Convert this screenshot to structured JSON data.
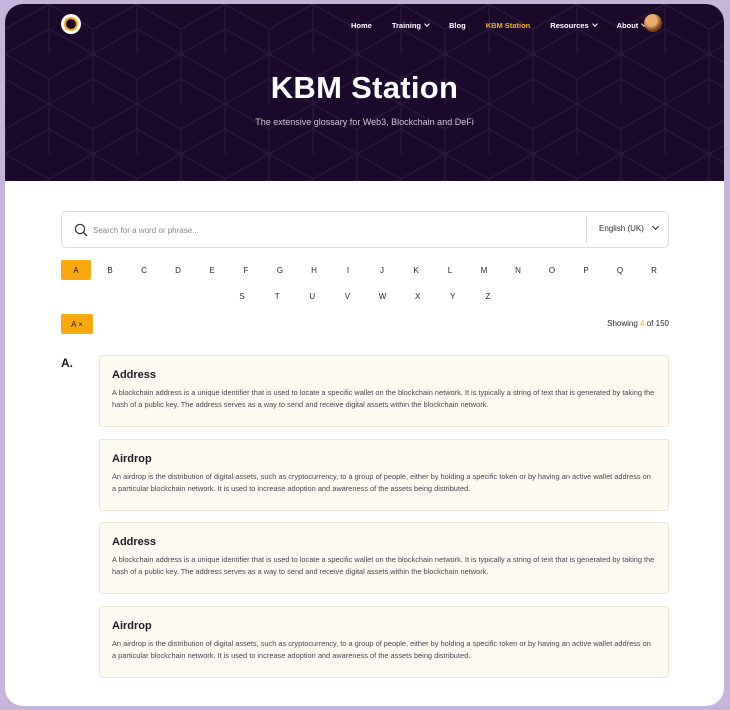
{
  "nav": {
    "items": [
      {
        "label": "Home",
        "dropdown": false,
        "active": false
      },
      {
        "label": "Training",
        "dropdown": true,
        "active": false
      },
      {
        "label": "Blog",
        "dropdown": false,
        "active": false
      },
      {
        "label": "KBM Station",
        "dropdown": false,
        "active": true
      },
      {
        "label": "Resources",
        "dropdown": true,
        "active": false
      },
      {
        "label": "About",
        "dropdown": true,
        "active": false
      }
    ]
  },
  "hero": {
    "title": "KBM Station",
    "subtitle": "The extensive glossary for Web3, Blockchain and DeFi"
  },
  "search": {
    "placeholder": "Search for a word or phrase...",
    "value": "",
    "language": "English (UK)"
  },
  "alphabet": {
    "row1": [
      "A",
      "B",
      "C",
      "D",
      "E",
      "F",
      "G",
      "H",
      "I",
      "J",
      "K",
      "L",
      "M",
      "N",
      "O",
      "P",
      "Q",
      "R"
    ],
    "row2": [
      "S",
      "T",
      "U",
      "V",
      "W",
      "X",
      "Y",
      "Z"
    ],
    "selected": "A"
  },
  "filter": {
    "chip_label": "A ×"
  },
  "results": {
    "prefix": "Showing",
    "shown": "4",
    "separator": "of",
    "total": "150"
  },
  "section": {
    "letter": "A.",
    "entries": [
      {
        "title": "Address",
        "body": "A blockchain address is a unique identifier that is used to locate a specific wallet on the blockchain network. It is typically a string of text that is generated by taking the hash of a public key. The address serves as a way to send and receive digital assets within the blockchain network."
      },
      {
        "title": "Airdrop",
        "body": "An airdrop is the distribution of digital assets, such as cryptocurrency, to a group of people, either by holding a specific token or by having an active wallet address on a particular blockchain network. It is used to increase adoption and awareness of the assets being distributed."
      },
      {
        "title": "Address",
        "body": "A blockchain address is a unique identifier that is used to locate a specific wallet on the blockchain network. It is typically a string of text that is generated by taking the hash of a public key. The address serves as a way to send and receive digital assets within the blockchain network."
      },
      {
        "title": "Airdrop",
        "body": "An airdrop is the distribution of digital assets, such as cryptocurrency, to a group of people, either by holding a specific token or by having an active wallet address on a particular blockchain network. It is used to increase adoption and awareness of the assets being distributed."
      }
    ]
  },
  "colors": {
    "hero_bg": "#1b0a2c",
    "accent": "#f8a910",
    "card_bg": "#fdfaf1",
    "frame_border": "#c7b4da"
  }
}
